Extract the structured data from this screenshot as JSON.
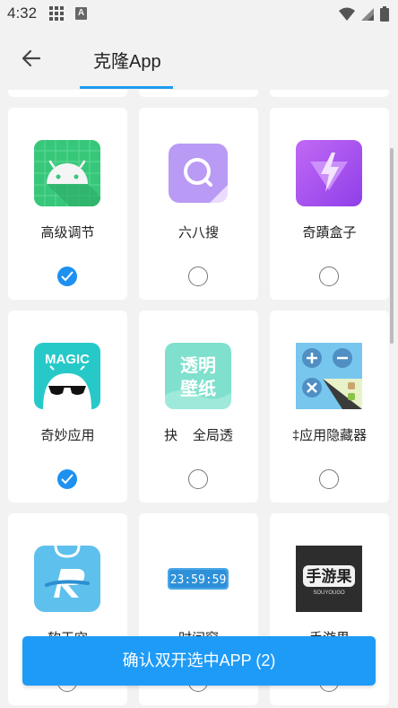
{
  "status_bar": {
    "time": "4:32"
  },
  "app_bar": {
    "title": "克隆App"
  },
  "apps": [
    {
      "label": "高级调节",
      "checked": true,
      "icon": "android-robot-icon"
    },
    {
      "label": "六八搜",
      "checked": false,
      "icon": "search-magnifier-icon"
    },
    {
      "label": "奇蹟盒子",
      "checked": false,
      "icon": "lightning-icon"
    },
    {
      "label": "奇妙应用",
      "checked": true,
      "icon": "magic-sunglasses-icon"
    },
    {
      "label": "抉    全局透",
      "checked": false,
      "icon": "transparent-wallpaper-icon"
    },
    {
      "label": "‡应用隐藏器",
      "checked": false,
      "icon": "app-hider-icon"
    },
    {
      "label": "软天空",
      "checked": false,
      "icon": "soft-sky-icon"
    },
    {
      "label": "时间窗",
      "checked": false,
      "icon": "time-window-icon"
    },
    {
      "label": "手游果",
      "checked": false,
      "icon": "shouyouguo-icon"
    }
  ],
  "icon_text": {
    "magic": "MAGIC",
    "wallpaper_line1": "透明",
    "wallpaper_line2": "壁纸",
    "clock": "23:59:59",
    "shouyouguo": "手游果",
    "shouyouguo_sub": "SOUYOUGO"
  },
  "confirm_button": {
    "label": "确认双开选中APP (2)"
  },
  "colors": {
    "accent": "#1e9bf7",
    "checked": "#1e90f0"
  }
}
